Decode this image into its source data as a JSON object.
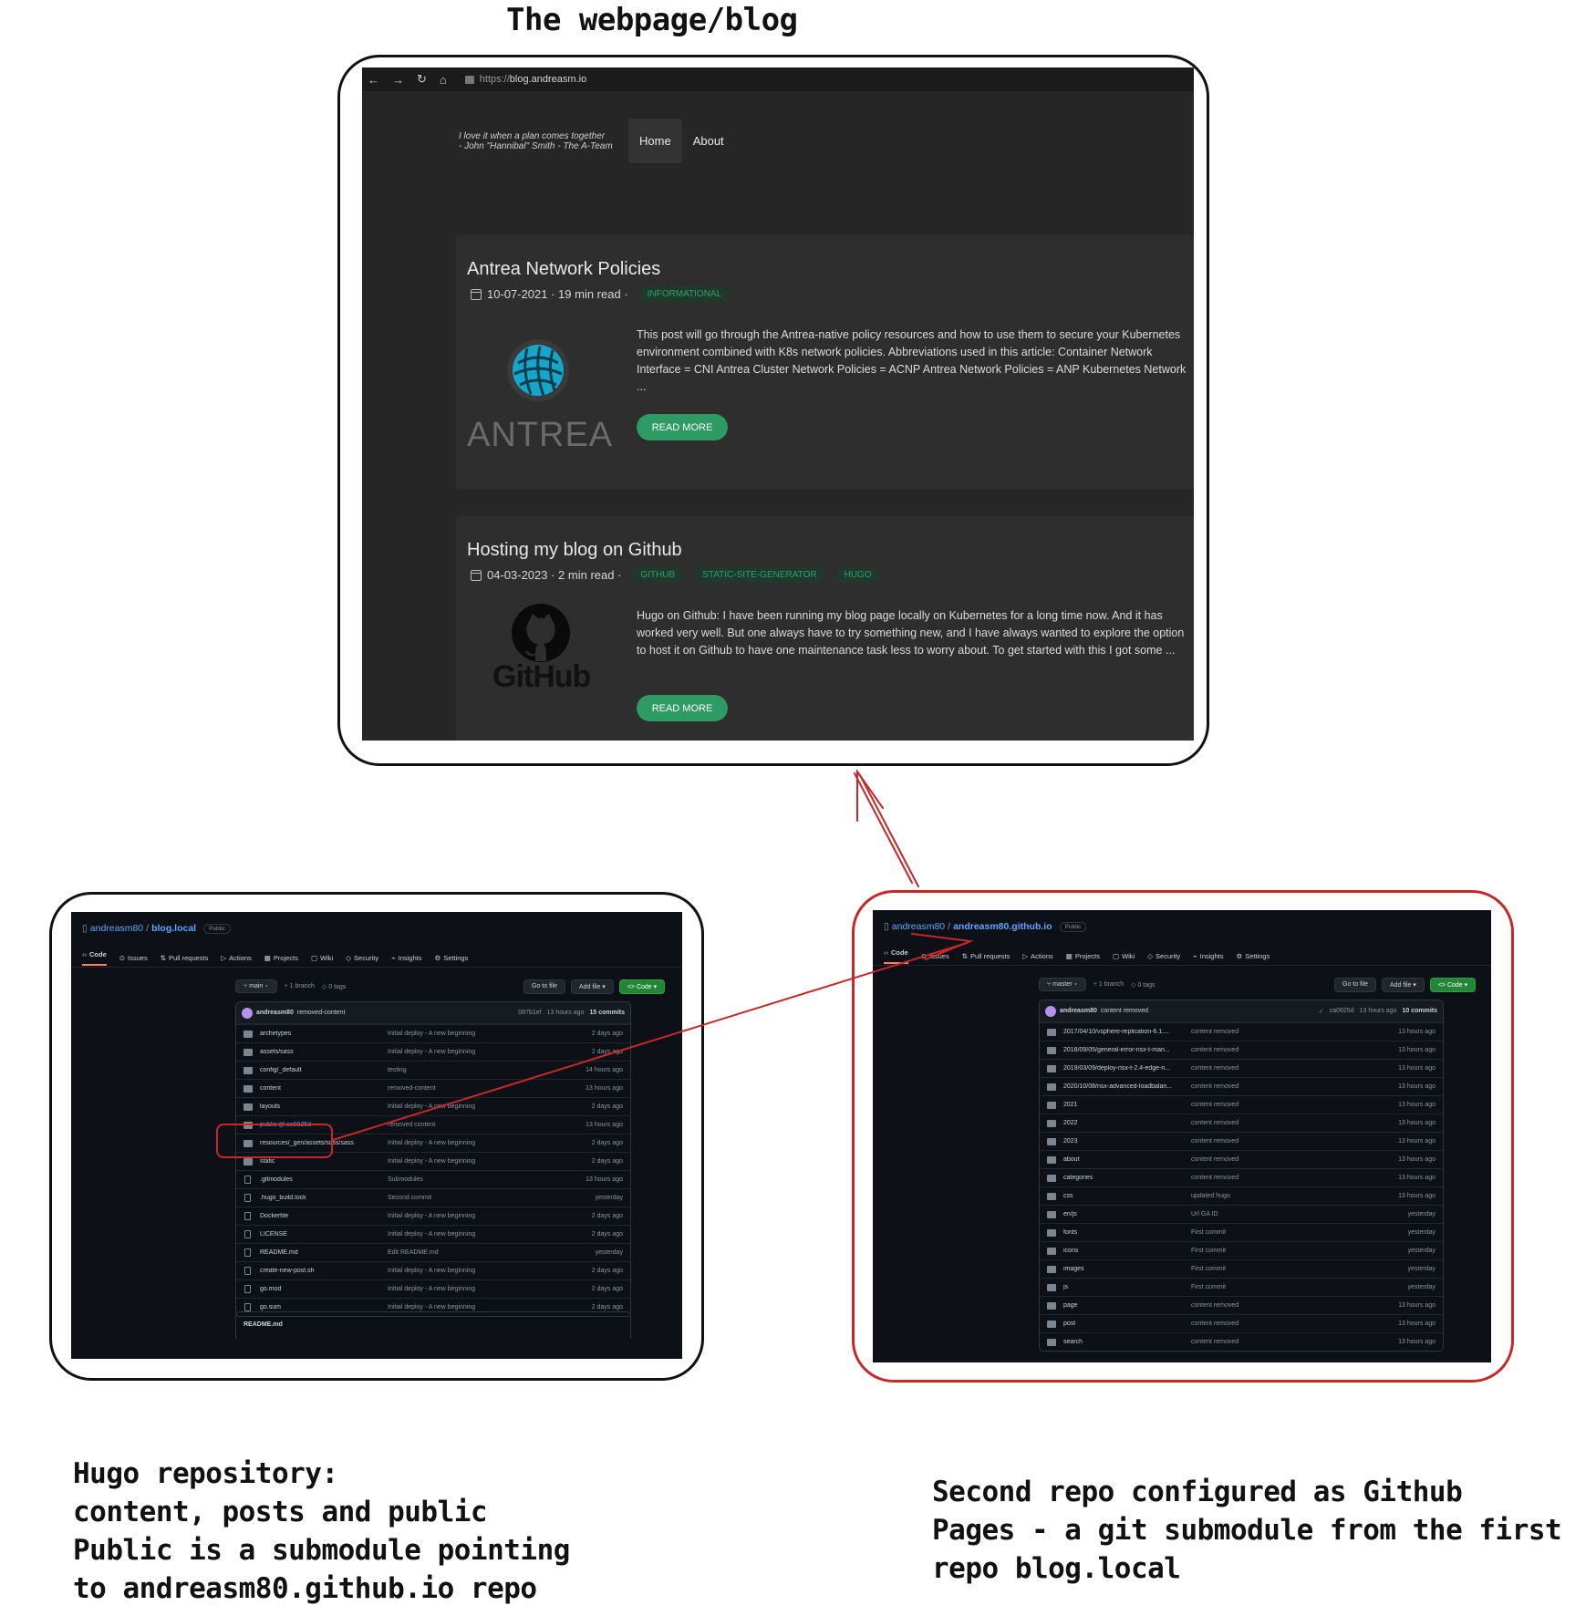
{
  "diagram_title": "The webpage/blog",
  "blog": {
    "url_prefix": "https://",
    "url_host": "blog.andreasm.io",
    "quote_line1": "I love it when a plan comes together",
    "quote_line2": "- John \"Hannibal\" Smith - The A-Team",
    "nav": [
      "Home",
      "About"
    ],
    "posts": [
      {
        "title": "Antrea Network Policies",
        "meta": "10-07-2021 · 19 min read ·",
        "tags": [
          "INFORMATIONAL"
        ],
        "excerpt": "This post will go through the Antrea-native policy resources and how to use them to secure your Kubernetes environment combined with K8s network policies. Abbreviations used in this article: Container Network Interface = CNI Antrea Cluster Network Policies = ACNP Antrea Network Policies = ANP Kubernetes Network ...",
        "button": "READ MORE",
        "logo_text": "ANTREA"
      },
      {
        "title": "Hosting my blog on Github",
        "meta": "04-03-2023 · 2 min read ·",
        "tags": [
          "GITHUB",
          "STATIC-SITE-GENERATOR",
          "HUGO"
        ],
        "excerpt": "Hugo on Github: I have been running my blog page locally on Kubernetes for a long time now. And it has worked very well. But one always have to try something new, and I have always wanted to explore the option to host it on Github to have one maintenance task less to worry about. To get started with this I got some ...",
        "button": "READ MORE",
        "logo_text": "GitHub"
      }
    ]
  },
  "repo_left": {
    "owner": "andreasm80",
    "name": "blog.local",
    "visibility": "Public",
    "tabs": [
      "Code",
      "Issues",
      "Pull requests",
      "Actions",
      "Projects",
      "Wiki",
      "Security",
      "Insights",
      "Settings"
    ],
    "branch": "main",
    "branches": "1 branch",
    "tags": "0 tags",
    "buttons": [
      "Go to file",
      "Add file ▾",
      "<> Code ▾"
    ],
    "commit_user": "andreasm80",
    "commit_msg": "removed-content",
    "commit_hash": "087b1ef",
    "commit_age": "13 hours ago",
    "commit_count": "15 commits",
    "files": [
      {
        "name": "archetypes",
        "type": "dir",
        "msg": "Initial deploy - A new beginning",
        "age": "2 days ago"
      },
      {
        "name": "assets/sass",
        "type": "dir",
        "msg": "Initial deploy - A new beginning",
        "age": "2 days ago"
      },
      {
        "name": "config/_default",
        "type": "dir",
        "msg": "testing",
        "age": "14 hours ago"
      },
      {
        "name": "content",
        "type": "dir",
        "msg": "removed-content",
        "age": "13 hours ago"
      },
      {
        "name": "layouts",
        "type": "dir",
        "msg": "Initial deploy - A new beginning",
        "age": "2 days ago"
      },
      {
        "name": "public @ ca0925d",
        "type": "submodule",
        "msg": "removed content",
        "age": "13 hours ago"
      },
      {
        "name": "resources/_gen/assets/scss/sass",
        "type": "dir",
        "msg": "Initial deploy - A new beginning",
        "age": "2 days ago"
      },
      {
        "name": "static",
        "type": "dir",
        "msg": "Initial deploy - A new beginning",
        "age": "2 days ago"
      },
      {
        "name": ".gitmodules",
        "type": "file",
        "msg": "Submodules",
        "age": "13 hours ago"
      },
      {
        "name": ".hugo_build.lock",
        "type": "file",
        "msg": "Second commit",
        "age": "yesterday"
      },
      {
        "name": "Dockerfile",
        "type": "file",
        "msg": "Initial deploy - A new beginning",
        "age": "2 days ago"
      },
      {
        "name": "LICENSE",
        "type": "file",
        "msg": "Initial deploy - A new beginning",
        "age": "2 days ago"
      },
      {
        "name": "README.md",
        "type": "file",
        "msg": "Edit README.md",
        "age": "yesterday"
      },
      {
        "name": "create-new-post.sh",
        "type": "file",
        "msg": "Initial deploy - A new beginning",
        "age": "2 days ago"
      },
      {
        "name": "go.mod",
        "type": "file",
        "msg": "Initial deploy - A new beginning",
        "age": "2 days ago"
      },
      {
        "name": "go.sum",
        "type": "file",
        "msg": "Initial deploy - A new beginning",
        "age": "2 days ago"
      }
    ],
    "readme": "README.md"
  },
  "repo_right": {
    "owner": "andreasm80",
    "name": "andreasm80.github.io",
    "visibility": "Public",
    "tabs": [
      "Code",
      "Issues",
      "Pull requests",
      "Actions",
      "Projects",
      "Wiki",
      "Security",
      "Insights",
      "Settings"
    ],
    "branch": "master",
    "branches": "1 branch",
    "tags": "0 tags",
    "buttons": [
      "Go to file",
      "Add file ▾",
      "<> Code ▾"
    ],
    "commit_user": "andreasm80",
    "commit_msg": "content removed",
    "commit_hash": "ca0925d",
    "commit_age": "13 hours ago",
    "commit_count": "10 commits",
    "files": [
      {
        "name": "2017/04/10/vsphere-replication-6.1....",
        "msg": "content removed",
        "age": "13 hours ago"
      },
      {
        "name": "2018/09/05/general-error-nsx-t-man...",
        "msg": "content removed",
        "age": "13 hours ago"
      },
      {
        "name": "2019/03/09/deploy-nsx-t-2.4-edge-n...",
        "msg": "content removed",
        "age": "13 hours ago"
      },
      {
        "name": "2020/10/08/nsx-advanced-loadbalan...",
        "msg": "content removed",
        "age": "13 hours ago"
      },
      {
        "name": "2021",
        "msg": "content removed",
        "age": "13 hours ago"
      },
      {
        "name": "2022",
        "msg": "content removed",
        "age": "13 hours ago"
      },
      {
        "name": "2023",
        "msg": "content removed",
        "age": "13 hours ago"
      },
      {
        "name": "about",
        "msg": "content removed",
        "age": "13 hours ago"
      },
      {
        "name": "categories",
        "msg": "content removed",
        "age": "13 hours ago"
      },
      {
        "name": "css",
        "msg": "updated hugo",
        "age": "13 hours ago"
      },
      {
        "name": "en/js",
        "msg": "Url GA ID",
        "age": "yesterday"
      },
      {
        "name": "fonts",
        "msg": "First commit",
        "age": "yesterday"
      },
      {
        "name": "icons",
        "msg": "First commit",
        "age": "yesterday"
      },
      {
        "name": "images",
        "msg": "First commit",
        "age": "yesterday"
      },
      {
        "name": "js",
        "msg": "First commit",
        "age": "yesterday"
      },
      {
        "name": "page",
        "msg": "content removed",
        "age": "13 hours ago"
      },
      {
        "name": "post",
        "msg": "content removed",
        "age": "13 hours ago"
      },
      {
        "name": "search",
        "msg": "content removed",
        "age": "13 hours ago"
      }
    ]
  },
  "notes": {
    "left": [
      "Hugo repository:",
      "content, posts and public",
      "Public is a submodule pointing",
      "to andreasm80.github.io repo"
    ],
    "right": [
      "Second repo configured as Github",
      "Pages - a git submodule from the first",
      "repo blog.local"
    ]
  },
  "colors": {
    "annotation_red": "#c62828",
    "github_bg": "#0d1117",
    "blog_bg": "#262626",
    "accent_green": "#2d9b63"
  }
}
